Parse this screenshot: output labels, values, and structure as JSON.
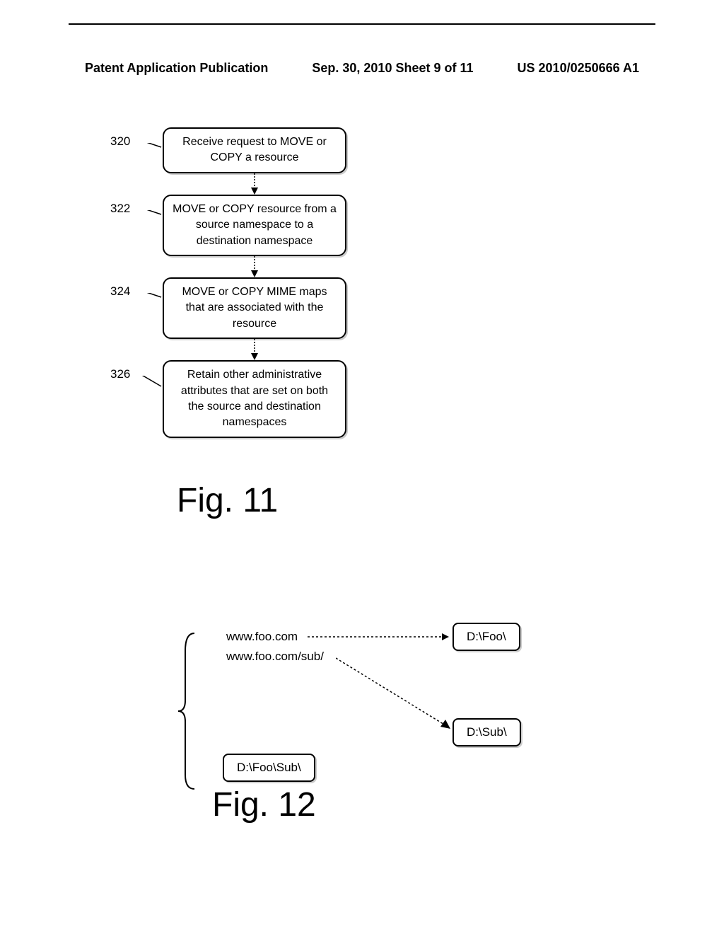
{
  "header": {
    "left": "Patent Application Publication",
    "center": "Sep. 30, 2010  Sheet 9 of 11",
    "right": "US 2010/0250666 A1"
  },
  "flowchart": {
    "steps": [
      {
        "label": "320",
        "text": "Receive request to MOVE or COPY a resource"
      },
      {
        "label": "322",
        "text": "MOVE or COPY resource from a source namespace to a destination namespace"
      },
      {
        "label": "324",
        "text": "MOVE or COPY MIME maps that are associated with the resource"
      },
      {
        "label": "326",
        "text": "Retain other administrative attributes that are set on both the source and destination namespaces"
      }
    ],
    "caption": "Fig. 11"
  },
  "mapping": {
    "url1": "www.foo.com",
    "url2": "www.foo.com/sub/",
    "dir_foo": "D:\\Foo\\",
    "dir_sub": "D:\\Sub\\",
    "dir_foosub": "D:\\Foo\\Sub\\",
    "caption": "Fig. 12"
  }
}
